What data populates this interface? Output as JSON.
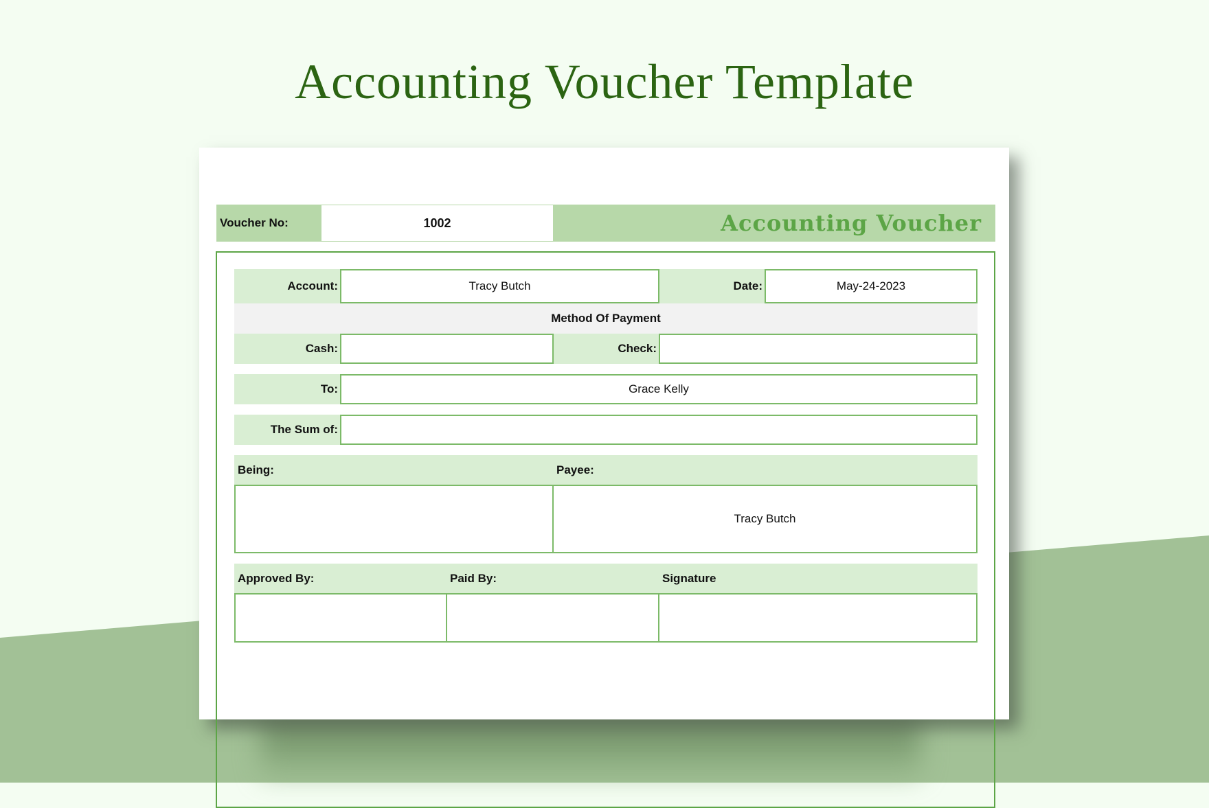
{
  "page_title": "Accounting Voucher Template",
  "voucher": {
    "number_label": "Voucher No:",
    "number_value": "1002",
    "heading": "Accounting Voucher",
    "account_label": "Account:",
    "account_value": "Tracy Butch",
    "date_label": "Date:",
    "date_value": "May-24-2023",
    "method_heading": "Method Of Payment",
    "cash_label": "Cash:",
    "cash_value": "",
    "check_label": "Check:",
    "check_value": "",
    "to_label": "To:",
    "to_value": "Grace Kelly",
    "sum_label": "The Sum of:",
    "sum_value": "",
    "being_label": "Being:",
    "being_value": "",
    "payee_label": "Payee:",
    "payee_value": "Tracy Butch",
    "approved_label": "Approved By:",
    "approved_value": "",
    "paid_label": "Paid By:",
    "paid_value": "",
    "signature_label": "Signature",
    "signature_value": ""
  },
  "colors": {
    "title_green": "#2b6412",
    "accent_green": "#5ca546",
    "header_fill": "#b7d8a9",
    "label_fill": "#d9eed3",
    "background_light": "#f4fdf2",
    "background_dark": "#a2c196"
  }
}
